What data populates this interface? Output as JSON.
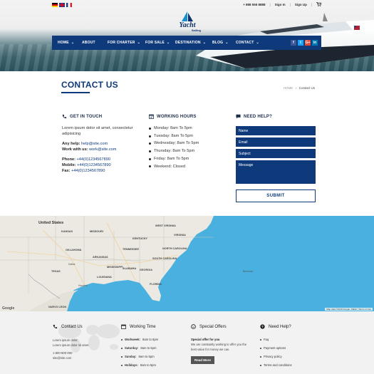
{
  "topbar": {
    "phone": "+ 888 555 8888",
    "sign_in": "Sign In",
    "sign_up": "Sign Up",
    "separator": "|"
  },
  "logo": {
    "text": "Yacht",
    "sub": "Sailing"
  },
  "nav": {
    "items": [
      {
        "label": "HOME",
        "caret": "⌄"
      },
      {
        "label": "ABOUT",
        "caret": ""
      },
      {
        "label": "FOR CHARTER",
        "caret": "⌄"
      },
      {
        "label": "FOR SALE",
        "caret": "⌄"
      },
      {
        "label": "DESTINATION",
        "caret": "⌄"
      },
      {
        "label": "BLOG",
        "caret": "⌄"
      },
      {
        "label": "CONTACT",
        "caret": "⌄"
      }
    ],
    "socials": [
      {
        "icon": "facebook-icon",
        "glyph": "f",
        "color": "#3b5998"
      },
      {
        "icon": "twitter-icon",
        "glyph": "t",
        "color": "#1da1f2"
      },
      {
        "icon": "google-plus-icon",
        "glyph": "G+",
        "color": "#dd4b39"
      },
      {
        "icon": "linkedin-icon",
        "glyph": "in",
        "color": "#0077b5"
      }
    ]
  },
  "title": {
    "heading": "CONTACT US",
    "breadcrumb_home": "HOME",
    "breadcrumb_sep": "»",
    "breadcrumb_current": "Contact Us"
  },
  "get_in_touch": {
    "heading": "GET IN TOUCH",
    "intro": "Lorem ipsum dolor sit amet, consectetur adipisicing",
    "help_label": "Any help:",
    "help_email": "help@site.com",
    "work_label": "Work with us:",
    "work_email": "work@site.com",
    "phone_label": "Phone:",
    "phone": "+44(0)1234567890",
    "mobile_label": "Mobile:",
    "mobile": "+44(0)1234567890",
    "fax_label": "Fax:",
    "fax": "+44(0)1234567890"
  },
  "working_hours": {
    "heading": "WORKING HOURS",
    "days": [
      "Monday: 8am To 5pm",
      "Tuesday: 8am To 5pm",
      "Wednesday: 8am To 5pm",
      "Thursday: 8am To 5pm",
      "Friday: 8am To 5pm",
      "Weekend: Closed"
    ]
  },
  "need_help": {
    "heading": "NEED HELP?",
    "name_placeholder": "Name",
    "email_placeholder": "Email",
    "subject_placeholder": "Subject",
    "message_placeholder": "Message",
    "submit": "SUBMIT"
  },
  "map": {
    "country": "United States",
    "states": [
      "KANSAS",
      "MISSOURI",
      "KENTUCKY",
      "TENNESSEE",
      "OKLAHOMA",
      "ARKANSAS",
      "TEXAS",
      "LOUISIANA",
      "MISSISSIPPI",
      "ALABAMA",
      "GEORGIA",
      "FLORIDA",
      "VIRGINIA",
      "NORTH CAROLINA",
      "SOUTH CAROLINA",
      "WEST VIRGINIA",
      "NUEVO LEON"
    ],
    "cities": [
      "Bermuda",
      "Dallas",
      "Houston"
    ],
    "credit": "Map data ©2019 Google, INEGI | Terms of Use",
    "google": "Google"
  },
  "footer": {
    "contact": {
      "heading": "Contact Us",
      "lines": [
        "Lorem ipsum dolor,",
        "Lorem ipsum dolor sit amet"
      ],
      "phone": "1-800-800-000",
      "email": "site@site.com"
    },
    "hours": {
      "heading": "Working Time",
      "items": [
        {
          "day": "Workweek:",
          "time": "8am to 5pm"
        },
        {
          "day": "Saturday:",
          "time": "8am to 5pm"
        },
        {
          "day": "Sunday:",
          "time": "8am to 5pm"
        },
        {
          "day": "Holidays:",
          "time": "8am to 5pm"
        }
      ]
    },
    "offers": {
      "heading": "Special Offers",
      "title": "Special offer for you",
      "text": "We are constantly working to offer you the best value for money we can.",
      "button": "Read More"
    },
    "help": {
      "heading": "Need Help?",
      "items": [
        "Faq",
        "Payment options",
        "Privacy policy",
        "Terms and conditions"
      ]
    }
  },
  "colors": {
    "primary": "#0e3a7c",
    "sea": "#49b0e0",
    "land": "#e9e9e4"
  }
}
